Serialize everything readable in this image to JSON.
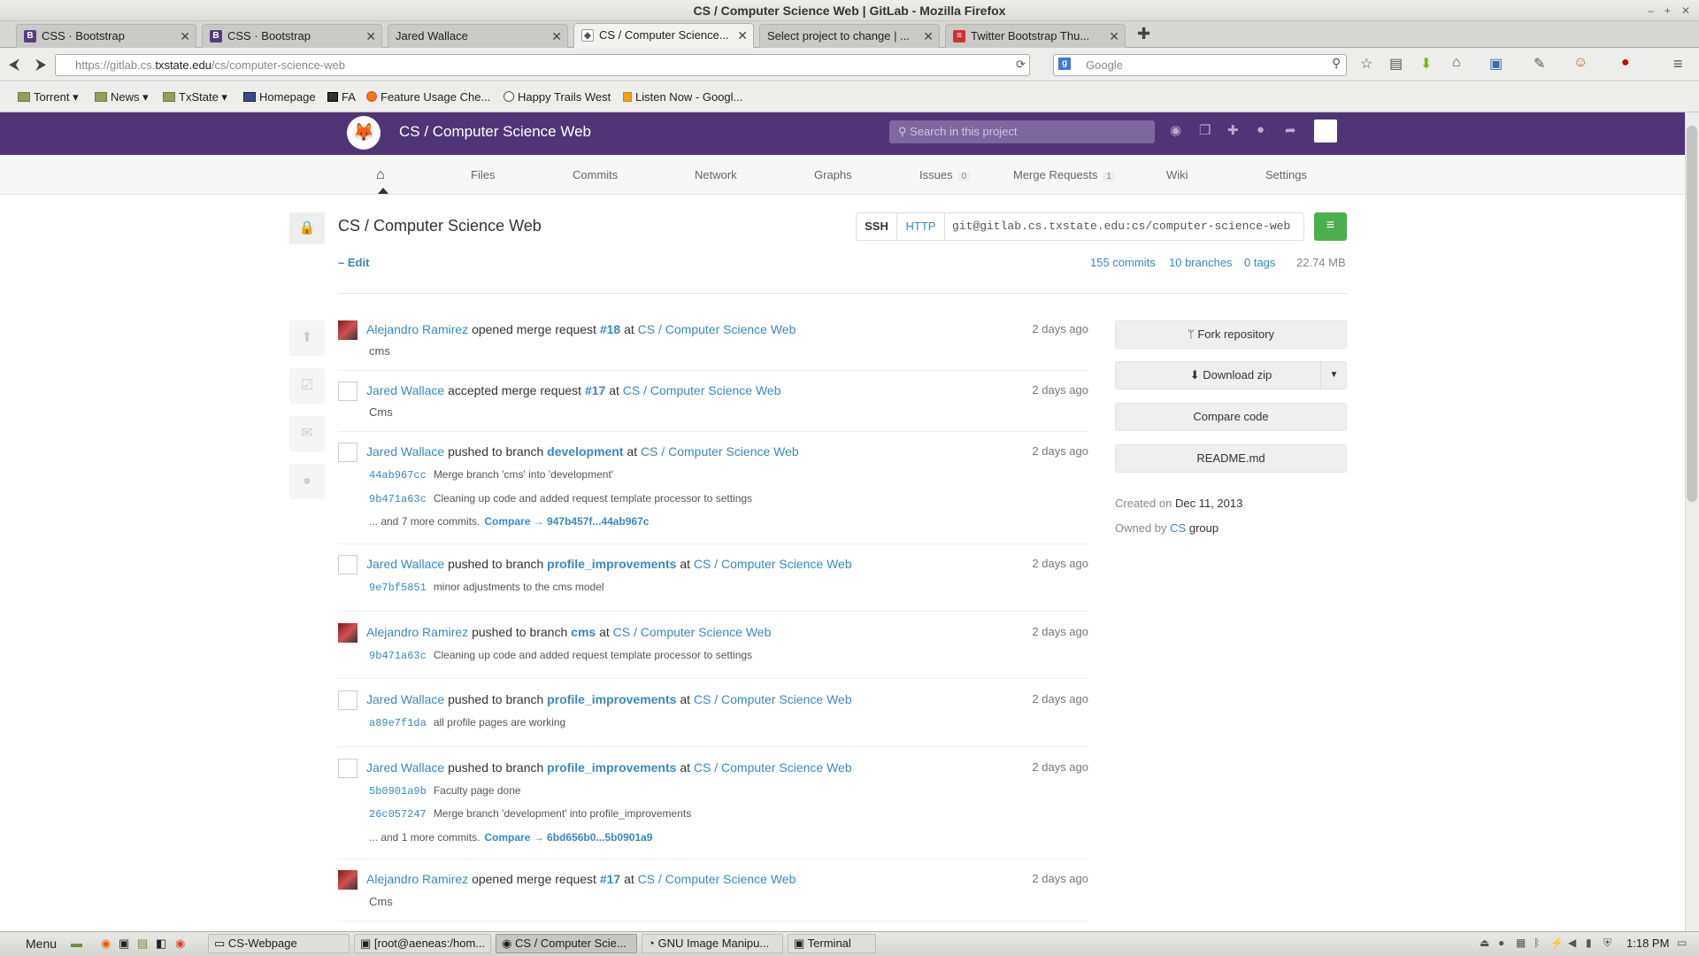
{
  "window": {
    "title": "CS / Computer Science Web | GitLab - Mozilla Firefox"
  },
  "tabs": [
    {
      "label": "CSS · Bootstrap",
      "icon": "bootstrap-icon"
    },
    {
      "label": "CSS · Bootstrap",
      "icon": "bootstrap-icon"
    },
    {
      "label": "Jared Wallace",
      "icon": "page-icon"
    },
    {
      "label": "CS / Computer Science...",
      "icon": "gitlab-icon",
      "active": true
    },
    {
      "label": "Select project to change | ...",
      "icon": "page-icon"
    },
    {
      "label": "Twitter Bootstrap Thu...",
      "icon": "page-icon"
    }
  ],
  "browser": {
    "url_prefix": "https://gitlab.cs.",
    "url_host": "txstate.edu",
    "url_path": "/cs/computer-science-web",
    "search_placeholder": "Google"
  },
  "bookmarks": [
    "Torrent",
    "News",
    "TxState",
    "Homepage",
    "FA",
    "Feature Usage Che...",
    "Happy Trails West",
    "Listen Now - Googl..."
  ],
  "header": {
    "project_title": "CS / Computer Science Web",
    "search_placeholder": "Search in this project"
  },
  "subnav": {
    "files": "Files",
    "commits": "Commits",
    "network": "Network",
    "graphs": "Graphs",
    "issues": "Issues",
    "issues_count": "0",
    "merge_requests": "Merge Requests",
    "merge_requests_count": "1",
    "wiki": "Wiki",
    "settings": "Settings"
  },
  "project": {
    "title": "CS / Computer Science Web",
    "edit": "– Edit",
    "clone_ssh": "SSH",
    "clone_http": "HTTP",
    "clone_url": "git@gitlab.cs.txstate.edu:cs/computer-science-web",
    "commits": "155 commits",
    "branches": "10 branches",
    "tags": "0 tags",
    "size": "22.74 MB"
  },
  "events": [
    {
      "author": "Alejandro Ramirez",
      "action": "opened merge request",
      "target": "#18",
      "at": "at",
      "project": "CS / Computer Science Web",
      "time": "2 days ago",
      "note": "cms"
    },
    {
      "author": "Jared Wallace",
      "action": "accepted merge request",
      "target": "#17",
      "at": "at",
      "project": "CS / Computer Science Web",
      "time": "2 days ago",
      "note": "Cms"
    },
    {
      "author": "Jared Wallace",
      "action": "pushed to branch",
      "target": "development",
      "at": "at",
      "project": "CS / Computer Science Web",
      "time": "2 days ago",
      "commits": [
        {
          "sha": "44ab967cc",
          "msg": "Merge branch 'cms' into 'development'"
        },
        {
          "sha": "9b471a63c",
          "msg": "Cleaning up code and added request template processor to settings"
        }
      ],
      "more": "... and 7 more commits.",
      "compare": "Compare → 947b457f...44ab967c"
    },
    {
      "author": "Jared Wallace",
      "action": "pushed to branch",
      "target": "profile_improvements",
      "at": "at",
      "project": "CS / Computer Science Web",
      "time": "2 days ago",
      "commits": [
        {
          "sha": "9e7bf5851",
          "msg": "minor adjustments to the cms model"
        }
      ]
    },
    {
      "author": "Alejandro Ramirez",
      "action": "pushed to branch",
      "target": "cms",
      "at": "at",
      "project": "CS / Computer Science Web",
      "time": "2 days ago",
      "commits": [
        {
          "sha": "9b471a63c",
          "msg": "Cleaning up code and added request template processor to settings"
        }
      ]
    },
    {
      "author": "Jared Wallace",
      "action": "pushed to branch",
      "target": "profile_improvements",
      "at": "at",
      "project": "CS / Computer Science Web",
      "time": "2 days ago",
      "commits": [
        {
          "sha": "a89e7f1da",
          "msg": "all profile pages are working"
        }
      ]
    },
    {
      "author": "Jared Wallace",
      "action": "pushed to branch",
      "target": "profile_improvements",
      "at": "at",
      "project": "CS / Computer Science Web",
      "time": "2 days ago",
      "commits": [
        {
          "sha": "5b0901a9b",
          "msg": "Faculty page done"
        },
        {
          "sha": "26c057247",
          "msg": "Merge branch 'development' into profile_improvements"
        }
      ],
      "more": "... and 1 more commits.",
      "compare": "Compare → 6bd656b0...5b0901a9"
    },
    {
      "author": "Alejandro Ramirez",
      "action": "opened merge request",
      "target": "#17",
      "at": "at",
      "project": "CS / Computer Science Web",
      "time": "2 days ago",
      "note": "Cms"
    }
  ],
  "sidebar": {
    "fork": "Fork repository",
    "download": "Download zip",
    "compare": "Compare code",
    "readme": "README.md",
    "created_label": "Created on",
    "created_date": "Dec 11, 2013",
    "owned_label": "Owned by",
    "owned_group": "CS",
    "owned_suffix": "group"
  },
  "taskbar": {
    "menu": "Menu",
    "tasks": [
      "CS-Webpage",
      "[root@aeneas:/hom...",
      "CS / Computer Scie...",
      "GNU Image Manipu...",
      "Terminal"
    ],
    "clock": "1:18 PM"
  }
}
